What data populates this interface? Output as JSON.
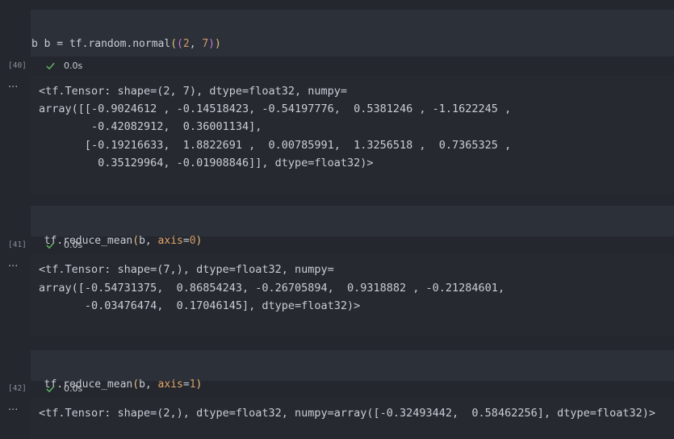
{
  "cells": [
    {
      "exec_count": "[40]",
      "status_time": "0.0s",
      "code": {
        "line1": {
          "var": "b",
          "eq": " = ",
          "call": "tf.random.normal",
          "p1": "(",
          "p2": "(",
          "n1": "2",
          "comma": ", ",
          "n2": "7",
          "p3": ")",
          "p4": ")"
        },
        "line2": "b"
      },
      "output": [
        "<tf.Tensor: shape=(2, 7), dtype=float32, numpy=",
        "array([[-0.9024612 , -0.14518423, -0.54197776,  0.5381246 , -1.1622245 ,",
        "        -0.42082912,  0.36001134],",
        "       [-0.19216633,  1.8822691 ,  0.00785991,  1.3256518 ,  0.7365325 ,",
        "         0.35129964, -0.01908846]], dtype=float32)>"
      ]
    },
    {
      "exec_count": "[41]",
      "status_time": "0.0s",
      "code": {
        "fn": "tf.reduce_mean",
        "p1": "(",
        "arg": "b, ",
        "kw": "axis",
        "eq": "=",
        "val": "0",
        "p2": ")"
      },
      "output": [
        "<tf.Tensor: shape=(7,), dtype=float32, numpy=",
        "array([-0.54731375,  0.86854243, -0.26705894,  0.9318882 , -0.21284601,",
        "       -0.03476474,  0.17046145], dtype=float32)>"
      ]
    },
    {
      "exec_count": "[42]",
      "status_time": "0.0s",
      "code": {
        "fn": "tf.reduce_mean",
        "p1": "(",
        "arg": "b, ",
        "kw": "axis",
        "eq": "=",
        "val": "1",
        "p2": ")"
      },
      "output": [
        "<tf.Tensor: shape=(2,), dtype=float32, numpy=array([-0.32493442,  0.58462256], dtype=float32)>"
      ]
    }
  ],
  "icons": {
    "status": "check-icon",
    "output_menu": "more-icon"
  },
  "colors": {
    "background": "#24272e",
    "code_cell": "#2c3038",
    "check": "#5fb760",
    "paren": "#e6c07b",
    "number": "#d19a66"
  }
}
